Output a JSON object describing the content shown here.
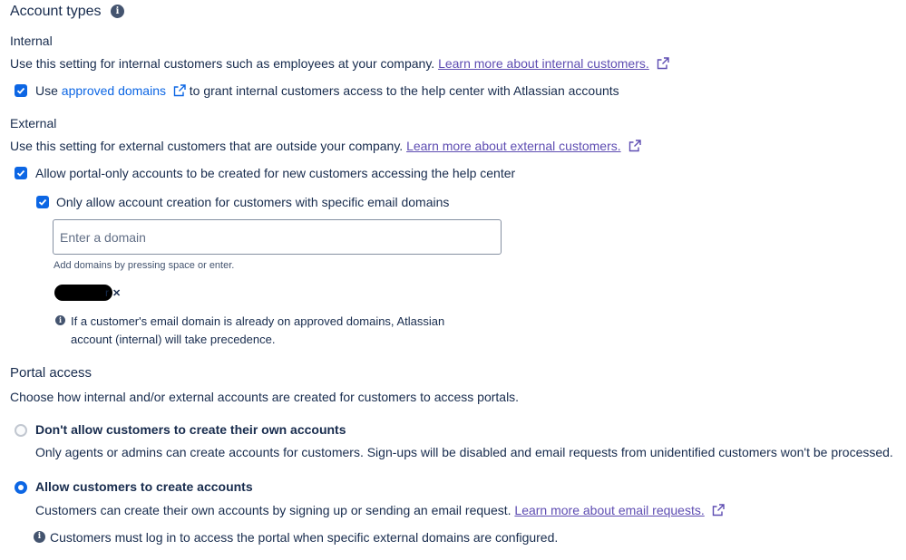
{
  "account_types": {
    "title": "Account types",
    "internal": {
      "heading": "Internal",
      "description": "Use this setting for internal customers such as employees at your company.",
      "learn_more": "Learn more about internal customers.",
      "checkbox_prefix": "Use",
      "checkbox_link": "approved domains",
      "checkbox_suffix": "to grant internal customers access to the help center with Atlassian accounts",
      "checked": true
    },
    "external": {
      "heading": "External",
      "description": "Use this setting for external customers that are outside your company.",
      "learn_more": "Learn more about external customers.",
      "portal_only_label": "Allow portal-only accounts to be created for new customers accessing the help center",
      "portal_only_checked": true,
      "specific_domains_label": "Only allow account creation for customers with specific email domains",
      "specific_domains_checked": true,
      "domain_input": {
        "value": "",
        "placeholder": "Enter a domain"
      },
      "helper_text": "Add domains by pressing space or enter.",
      "domain_tags": [
        {
          "label": "r"
        }
      ],
      "note_line1": "If a customer's email domain is already on approved domains, Atlassian",
      "note_line2": "account (internal) will take precedence."
    }
  },
  "portal_access": {
    "title": "Portal access",
    "description": "Choose how internal and/or external accounts are created for customers to access portals.",
    "options": [
      {
        "label": "Don't allow customers to create their own accounts",
        "description": "Only agents or admins can create accounts for customers. Sign-ups will be disabled and email requests from unidentified customers won't be processed.",
        "selected": false
      },
      {
        "label": "Allow customers to create accounts",
        "description": "Customers can create their own accounts by signing up or sending an email request.",
        "learn_more": "Learn more about email requests.",
        "selected": true
      }
    ],
    "note": "Customers must log in to access the portal when specific external domains are configured."
  },
  "icons": {
    "info": "info-icon",
    "external_link": "external-link-icon",
    "check": "check-icon",
    "remove_tag": "close-icon"
  },
  "colors": {
    "accent": "#0c66e4",
    "link_visited": "#5e4db2",
    "text": "#172b4d"
  }
}
